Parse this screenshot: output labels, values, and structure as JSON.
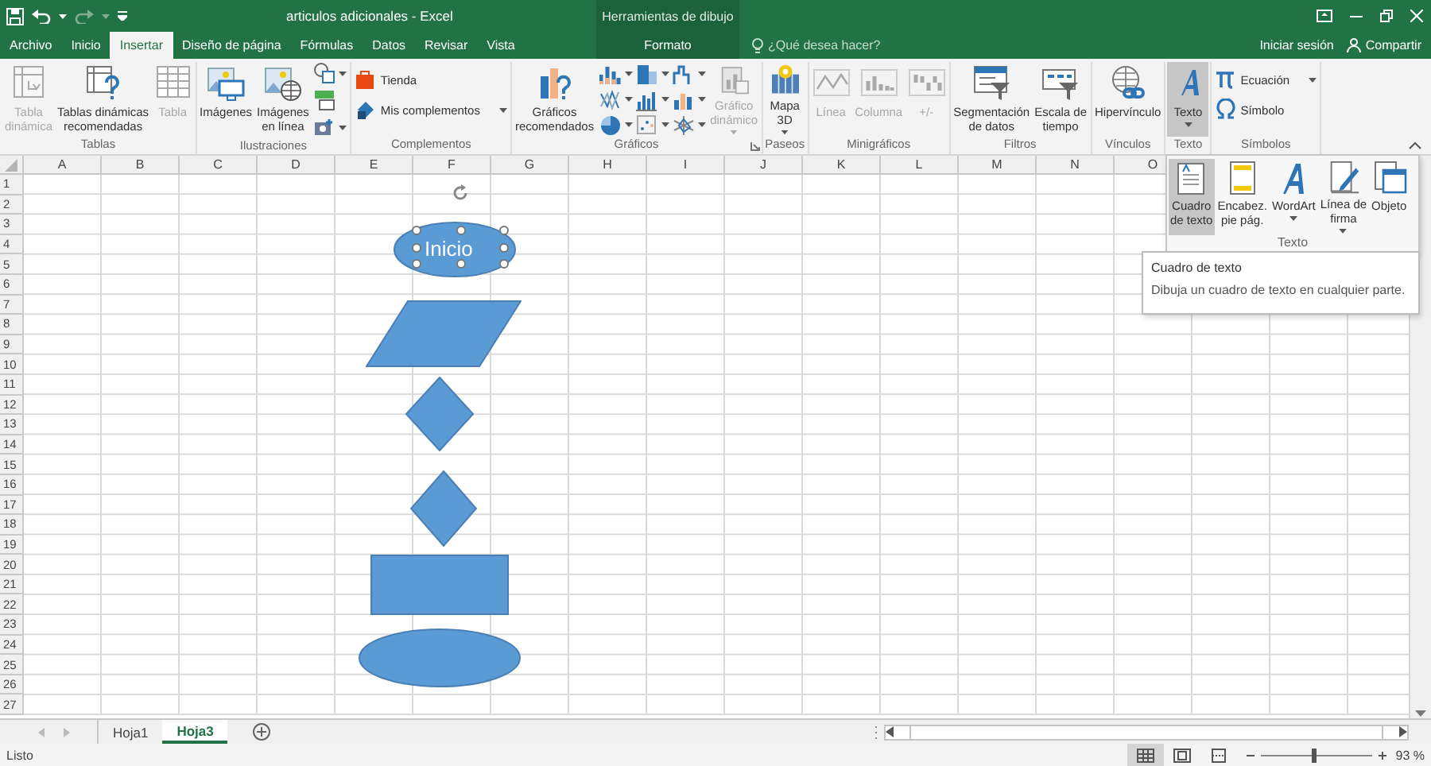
{
  "title_bar": {
    "title": "articulos adicionales - Excel",
    "context_label": "Herramientas de dibujo"
  },
  "tabs": [
    {
      "label": "Archivo",
      "selected": false,
      "contextual": false
    },
    {
      "label": "Inicio",
      "selected": false,
      "contextual": false
    },
    {
      "label": "Insertar",
      "selected": true,
      "contextual": false
    },
    {
      "label": "Diseño de página",
      "selected": false,
      "contextual": false
    },
    {
      "label": "Fórmulas",
      "selected": false,
      "contextual": false
    },
    {
      "label": "Datos",
      "selected": false,
      "contextual": false
    },
    {
      "label": "Revisar",
      "selected": false,
      "contextual": false
    },
    {
      "label": "Vista",
      "selected": false,
      "contextual": false
    },
    {
      "label": "Formato",
      "selected": false,
      "contextual": true
    }
  ],
  "search": {
    "placeholder": "¿Qué desea hacer?"
  },
  "account": {
    "sign_in": "Iniciar sesión",
    "share": "Compartir"
  },
  "ribbon": {
    "groups": [
      {
        "label": "Tablas",
        "commands": [
          {
            "kind": "large",
            "label": "Tabla\ndinámica",
            "disabled": true
          },
          {
            "kind": "large",
            "label": "Tablas dinámicas\nrecomendadas",
            "disabled": false
          },
          {
            "kind": "large",
            "label": "Tabla",
            "disabled": true
          }
        ]
      },
      {
        "label": "Ilustraciones",
        "commands": [
          {
            "kind": "large",
            "label": "Imágenes",
            "disabled": false
          },
          {
            "kind": "large",
            "label": "Imágenes\nen línea",
            "disabled": false
          },
          {
            "kind": "icons",
            "items": [
              {
                "dropdown": true
              },
              {
                "dropdown": false
              },
              {
                "dropdown": true
              }
            ]
          }
        ]
      },
      {
        "label": "Complementos",
        "commands": [
          {
            "kind": "stack",
            "items": [
              {
                "label": "Tienda",
                "dropdown": false
              },
              {
                "label": "Mis complementos",
                "dropdown": true
              }
            ]
          }
        ]
      },
      {
        "label": "Gráficos",
        "launcher": true,
        "commands": [
          {
            "kind": "large",
            "label": "Gráficos\nrecomendados",
            "disabled": false
          },
          {
            "kind": "grid",
            "items": [
              {
                "dropdown": true
              },
              {
                "dropdown": true
              },
              {
                "dropdown": true
              },
              {
                "dropdown": true
              },
              {
                "dropdown": true
              },
              {
                "dropdown": true
              },
              {
                "dropdown": true
              },
              {
                "dropdown": true
              },
              {
                "dropdown": true
              }
            ]
          },
          {
            "kind": "large",
            "label": "Gráfico\ndinámico",
            "disabled": true,
            "dropdown": true
          }
        ]
      },
      {
        "label": "Paseos",
        "commands": [
          {
            "kind": "large",
            "label": "Mapa\n3D",
            "disabled": false,
            "dropdown": true
          }
        ]
      },
      {
        "label": "Minigráficos",
        "commands": [
          {
            "kind": "large",
            "label": "Línea",
            "disabled": true
          },
          {
            "kind": "large",
            "label": "Columna",
            "disabled": true
          },
          {
            "kind": "large",
            "label": "+/-",
            "disabled": true
          }
        ]
      },
      {
        "label": "Filtros",
        "commands": [
          {
            "kind": "large",
            "label": "Segmentación\nde datos",
            "disabled": false
          },
          {
            "kind": "large",
            "label": "Escala de\ntiempo",
            "disabled": false
          }
        ]
      },
      {
        "label": "Vínculos",
        "commands": [
          {
            "kind": "large",
            "label": "Hipervínculo",
            "disabled": false
          }
        ]
      },
      {
        "label": "Texto",
        "commands": [
          {
            "kind": "large",
            "label": "Texto",
            "disabled": false,
            "dropdown": true,
            "pressed": true
          }
        ]
      },
      {
        "label": "Símbolos",
        "commands": [
          {
            "kind": "stack",
            "items": [
              {
                "label": "Ecuación",
                "dropdown": true
              },
              {
                "label": "Símbolo",
                "dropdown": false
              }
            ]
          }
        ]
      }
    ]
  },
  "gallery": {
    "label": "Texto",
    "items": [
      {
        "label": "Cuadro\nde texto",
        "selected": true,
        "dropdown": false
      },
      {
        "label": "Encabez.\npie pág.",
        "selected": false,
        "dropdown": false
      },
      {
        "label": "WordArt",
        "selected": false,
        "dropdown": true
      },
      {
        "label": "Línea de\nfirma",
        "selected": false,
        "dropdown": true
      },
      {
        "label": "Objeto",
        "selected": false,
        "dropdown": false
      }
    ]
  },
  "tooltip": {
    "title": "Cuadro de texto",
    "description": "Dibuja un cuadro de texto en cualquier parte."
  },
  "sheet": {
    "columns": [
      "A",
      "B",
      "C",
      "D",
      "E",
      "F",
      "G",
      "H",
      "I",
      "J",
      "K",
      "L",
      "M",
      "N",
      "O"
    ],
    "rows": [
      "1",
      "2",
      "3",
      "4",
      "5",
      "6",
      "7",
      "8",
      "9",
      "10",
      "11",
      "12",
      "13",
      "14",
      "15",
      "16",
      "17",
      "18",
      "19",
      "20",
      "21",
      "22",
      "23",
      "24",
      "25",
      "26",
      "27"
    ],
    "shapes": [
      {
        "kind": "ellipse",
        "text": "Inicio",
        "selected": true
      },
      {
        "kind": "parallelogram",
        "selected": false
      },
      {
        "kind": "diamond",
        "selected": false
      },
      {
        "kind": "diamond",
        "selected": false
      },
      {
        "kind": "rectangle",
        "selected": false
      },
      {
        "kind": "ellipse",
        "selected": false
      }
    ]
  },
  "sheet_tabs": [
    {
      "label": "Hoja1",
      "selected": false
    },
    {
      "label": "Hoja3",
      "selected": true
    }
  ],
  "status_bar": {
    "status": "Listo",
    "views": [
      {
        "selected": true
      },
      {
        "selected": false
      },
      {
        "selected": false
      }
    ],
    "zoom": {
      "level": 0.48,
      "reading": "93 %"
    }
  }
}
